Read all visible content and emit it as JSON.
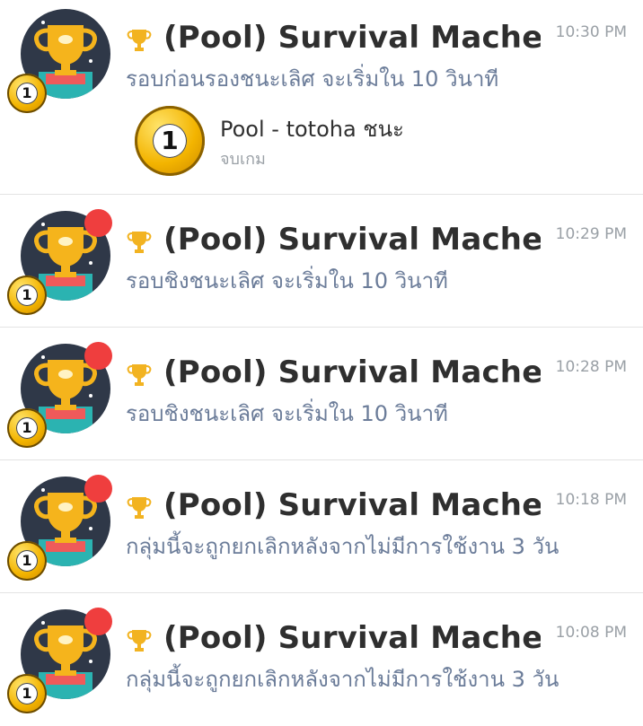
{
  "items": [
    {
      "title": "(Pool) Survival Machet...",
      "time": "10:30 PM",
      "message": "รอบก่อนรองชนะเลิศ จะเริ่มใน 10 วินาที",
      "unread": false,
      "attachment": {
        "title": "Pool - totoha ชนะ",
        "status": "จบเกม",
        "ball_number": "1"
      }
    },
    {
      "title": "(Pool) Survival Machet...",
      "time": "10:29 PM",
      "message": "รอบชิงชนะเลิศ จะเริ่มใน 10 วินาที",
      "unread": true
    },
    {
      "title": "(Pool) Survival Machet...",
      "time": "10:28 PM",
      "message": "รอบชิงชนะเลิศ จะเริ่มใน 10 วินาที",
      "unread": true
    },
    {
      "title": "(Pool) Survival Machet...",
      "time": "10:18 PM",
      "message": "กลุ่มนี้จะถูกยกเลิกหลังจากไม่มีการใช้งาน 3 วัน",
      "unread": true
    },
    {
      "title": "(Pool) Survival Machet...",
      "time": "10:08 PM",
      "message": "กลุ่มนี้จะถูกยกเลิกหลังจากไม่มีการใช้งาน 3 วัน",
      "unread": true
    }
  ],
  "avatar_ball_number": "1",
  "colors": {
    "unread": "#ef3e3e",
    "avatar_bg": "#2f3848",
    "title": "#2f2f2f",
    "subtitle": "#6b7c99",
    "time": "#9aa0a6"
  },
  "icons": {
    "trophy": "trophy-icon",
    "pool_ball": "pool-ball-icon",
    "badge": "unread-badge"
  }
}
